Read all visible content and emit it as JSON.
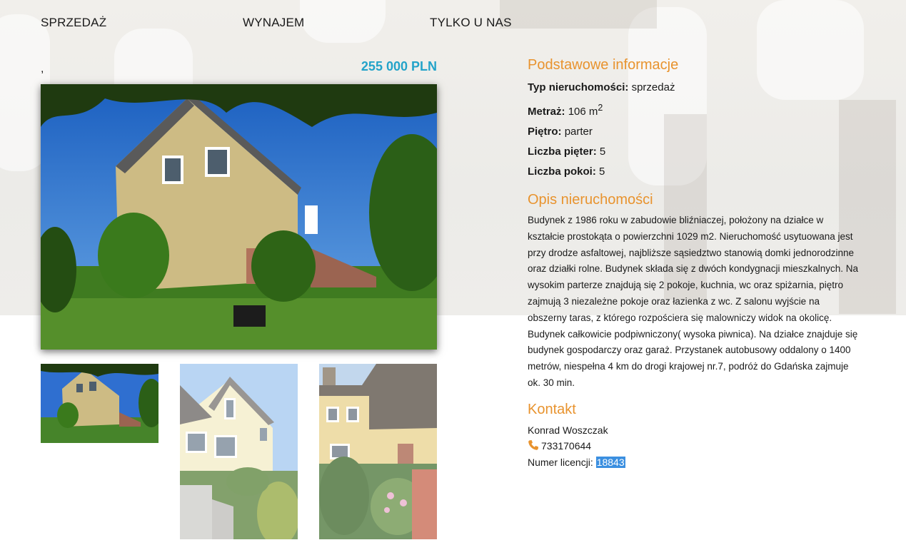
{
  "nav": {
    "items": [
      "SPRZEDAŻ",
      "WYNAJEM",
      "TYLKO U NAS"
    ]
  },
  "listing": {
    "title_fragment": ",",
    "price": "255 000 PLN"
  },
  "basic": {
    "heading": "Podstawowe informacje",
    "rows": [
      {
        "label": "Typ nieruchomości:",
        "value": "sprzedaż"
      },
      {
        "label": "Metraż:",
        "value": "106 m",
        "sup": "2"
      },
      {
        "label": "Piętro:",
        "value": "parter"
      },
      {
        "label": "Liczba pięter:",
        "value": "5"
      },
      {
        "label": "Liczba pokoi:",
        "value": "5"
      }
    ]
  },
  "description": {
    "heading": "Opis nieruchomości",
    "text": "Budynek z 1986 roku w zabudowie bliźniaczej, położony na działce w kształcie prostokąta o powierzchni 1029 m2. Nieruchomość usytuowana jest przy drodze asfaltowej, najbliższe sąsiedztwo stanowią domki jednorodzinne oraz działki rolne. Budynek składa się z dwóch kondygnacji mieszkalnych. Na wysokim parterze znajdują się 2 pokoje, kuchnia, wc oraz spiżarnia, piętro zajmują 3 niezależne pokoje oraz łazienka z wc. Z salonu wyjście na obszerny taras, z którego rozpościera się malowniczy widok na okolicę. Budynek całkowicie podpiwniczony( wysoka piwnica). Na działce znajduje się budynek gospodarczy oraz garaż. Przystanek autobusowy oddalony o 1400 metrów, niespełna 4 km do drogi krajowej nr.7, podróż do Gdańska zajmuje ok. 30 min."
  },
  "contact": {
    "heading": "Kontakt",
    "name": "Konrad Woszczak",
    "phone": "733170644",
    "license_label": "Numer licencji:",
    "license_number": "18843"
  },
  "icons": {
    "phone": "phone-icon"
  },
  "colors": {
    "accent": "#e8932e",
    "price": "#23a3c9",
    "highlight": "#3b8fe0"
  }
}
